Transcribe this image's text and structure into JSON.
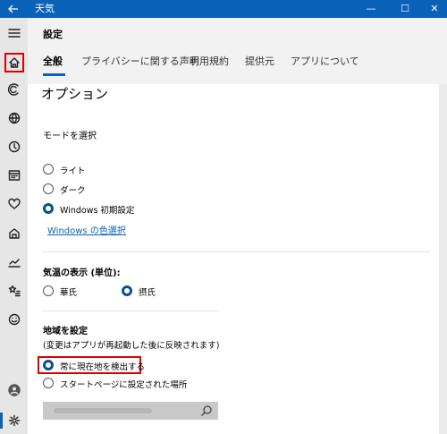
{
  "titlebar": {
    "back_icon": "back-arrow-icon",
    "title": "天気",
    "minimize": "—",
    "maximize": "☐",
    "close": "✕"
  },
  "sidebar": {
    "items": [
      {
        "name": "menu-icon"
      },
      {
        "name": "home-icon"
      },
      {
        "name": "forecast-icon"
      },
      {
        "name": "globe-icon"
      },
      {
        "name": "clock-icon"
      },
      {
        "name": "calendar-icon"
      },
      {
        "name": "heart-icon"
      },
      {
        "name": "news-icon"
      },
      {
        "name": "chart-icon"
      },
      {
        "name": "favorites-icon"
      },
      {
        "name": "smile-icon"
      },
      {
        "name": "account-icon"
      },
      {
        "name": "settings-icon"
      }
    ]
  },
  "header": {
    "title": "設定",
    "tabs": [
      {
        "label": "全般"
      },
      {
        "label": "プライバシーに関する声明"
      },
      {
        "label": "利用規約"
      },
      {
        "label": "提供元"
      },
      {
        "label": "アプリについて"
      }
    ]
  },
  "options": {
    "title": "オプション",
    "mode_label": "モードを選択",
    "mode_options": [
      {
        "label": "ライト",
        "selected": false
      },
      {
        "label": "ダーク",
        "selected": false
      },
      {
        "label": "Windows 初期設定",
        "selected": true
      }
    ],
    "windows_color_link": "Windows の色選択",
    "temp_label": "気温の表示 (単位):",
    "temp_options": [
      {
        "label": "華氏",
        "selected": false
      },
      {
        "label": "摂氏",
        "selected": true
      }
    ],
    "region_label": "地域を設定",
    "region_note": "(変更はアプリが再起動した後に反映されます)",
    "region_options": [
      {
        "label": "常に現在地を検出する",
        "selected": true
      },
      {
        "label": "スタートページに設定された場所",
        "selected": false
      }
    ],
    "search_icon": "search-icon"
  },
  "colors": {
    "accent": "#0a62b8",
    "highlight": "#e00000"
  }
}
